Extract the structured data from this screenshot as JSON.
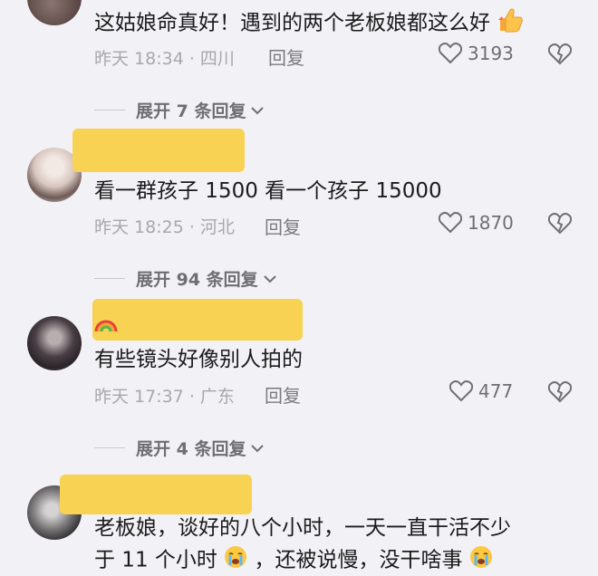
{
  "comments": [
    {
      "text": "这姑娘命真好！遇到的两个老板娘都这么好",
      "meta": "昨天 18:34 · 四川",
      "reply": "回复",
      "likes": "3193"
    },
    {
      "text": "看一群孩子 1500 看一个孩子 15000",
      "meta": "昨天 18:25 · 河北",
      "reply": "回复",
      "likes": "1870"
    },
    {
      "text": "有些镜头好像别人拍的",
      "meta": "昨天 17:37 · 广东",
      "reply": "回复",
      "likes": "477"
    },
    {
      "text_line1": "老板娘，谈好的八个小时，一天一直干活不少",
      "text_line2a": "于 11 个小时",
      "text_line2b": "，还被说慢，没干啥事"
    }
  ],
  "expand": [
    {
      "label": "展开 7 条回复"
    },
    {
      "label": "展开 94 条回复"
    },
    {
      "label": "展开 4 条回复"
    }
  ],
  "icons": {
    "heart": "heart-icon",
    "broken_heart": "broken-heart-icon",
    "chevron": "chevron-down-icon",
    "thumbs_up": "thumbs-up-emoji",
    "crying": "crying-emoji",
    "rainbow": "rainbow-emoji"
  },
  "colors": {
    "username_highlight": "#f8d253",
    "meta_text": "#a8a7ad"
  }
}
